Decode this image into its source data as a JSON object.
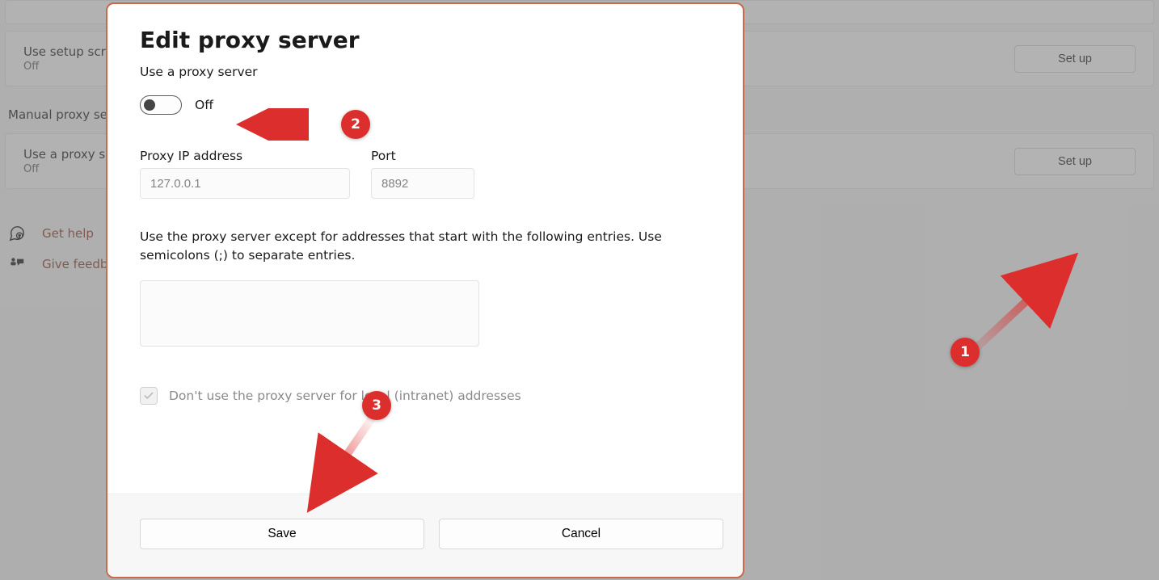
{
  "background": {
    "setup_card": {
      "title": "Use setup script",
      "status": "Off",
      "button": "Set up"
    },
    "manual_heading": "Manual proxy setup",
    "proxy_card": {
      "title": "Use a proxy server",
      "status": "Off",
      "button": "Set up"
    },
    "help_link": "Get help",
    "feedback_link": "Give feedback"
  },
  "dialog": {
    "title": "Edit proxy server",
    "use_proxy_label": "Use a proxy server",
    "toggle_state": "Off",
    "ip_label": "Proxy IP address",
    "ip_placeholder": "127.0.0.1",
    "port_label": "Port",
    "port_placeholder": "8892",
    "exceptions_desc": "Use the proxy server except for addresses that start with the following entries. Use semicolons (;) to separate entries.",
    "local_bypass_label": "Don't use the proxy server for local (intranet) addresses",
    "save": "Save",
    "cancel": "Cancel"
  },
  "annotations": {
    "a1": "1",
    "a2": "2",
    "a3": "3"
  }
}
